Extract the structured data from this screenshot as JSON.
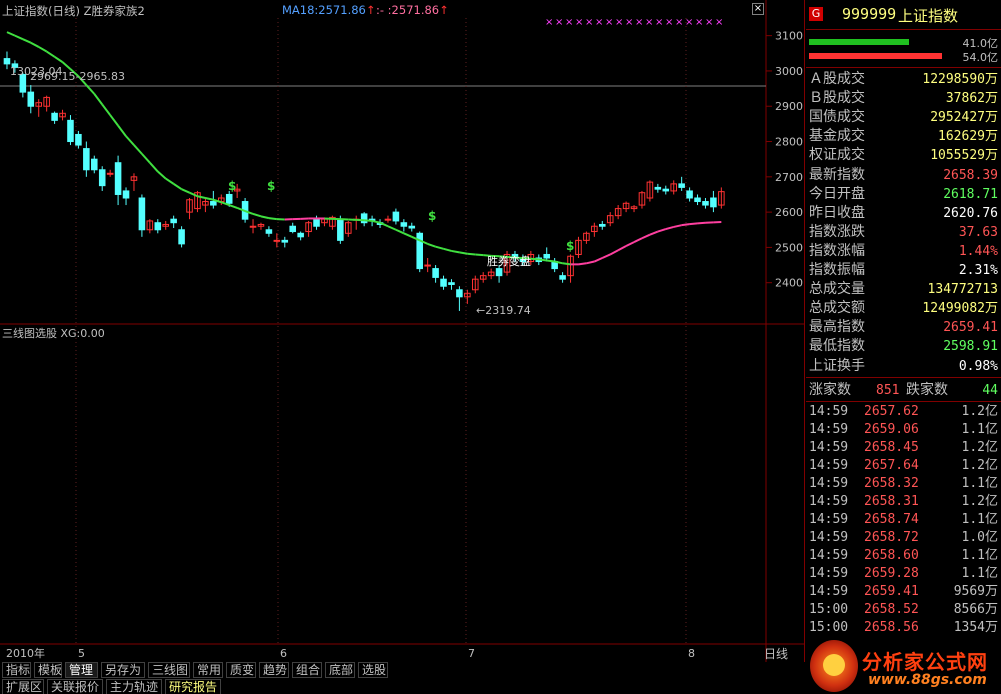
{
  "header": {
    "title": "上证指数(日线) Z胜券家族2",
    "ma_label": "MA18:2571.86",
    "ma_label2": ":- :2571.86"
  },
  "y_axis": [
    "3100",
    "3000",
    "2900",
    "2800",
    "2700",
    "2600",
    "2500",
    "2400"
  ],
  "annotations": {
    "high_label": "13023.04",
    "range_label": "2969.15-2965.83",
    "low_label": "←2319.74",
    "signal_text": "胜券变盘"
  },
  "indicator": {
    "label": "三线图选股  XG:0.00"
  },
  "x_axis": [
    "2010年",
    "5",
    "6",
    "7",
    "8"
  ],
  "period": "日线",
  "colors": {
    "up": "#ff3232",
    "down": "#54ffff",
    "ma_green": "#40e040",
    "ma_pink": "#ff3fa0",
    "axis": "#800000"
  },
  "panel": {
    "code": "999999",
    "name": "上证指数",
    "g_badge": "G",
    "bar1_label": "41.0亿",
    "bar2_label": "54.0亿",
    "stats": [
      {
        "label": "Ａ股成交",
        "value": "12298590万",
        "color": "#ffff80"
      },
      {
        "label": "Ｂ股成交",
        "value": "37862万",
        "color": "#ffff80"
      },
      {
        "label": "国债成交",
        "value": "2952427万",
        "color": "#ffff80"
      },
      {
        "label": "基金成交",
        "value": "162629万",
        "color": "#ffff80"
      },
      {
        "label": "权证成交",
        "value": "1055529万",
        "color": "#ffff80"
      },
      {
        "label": "最新指数",
        "value": "2658.39",
        "color": "#ff5555"
      },
      {
        "label": "今日开盘",
        "value": "2618.71",
        "color": "#60ff60"
      },
      {
        "label": "昨日收盘",
        "value": "2620.76",
        "color": "#ffffff"
      },
      {
        "label": "指数涨跌",
        "value": "37.63",
        "color": "#ff5555"
      },
      {
        "label": "指数涨幅",
        "value": "1.44%",
        "color": "#ff5555"
      },
      {
        "label": "指数振幅",
        "value": "2.31%",
        "color": "#ffffff"
      },
      {
        "label": "总成交量",
        "value": "134772713",
        "color": "#ffff80"
      },
      {
        "label": "总成交额",
        "value": "12499082万",
        "color": "#ffff80"
      },
      {
        "label": "最高指数",
        "value": "2659.41",
        "color": "#ff5555"
      },
      {
        "label": "最低指数",
        "value": "2598.91",
        "color": "#60ff60"
      },
      {
        "label": "上证换手",
        "value": "0.98%",
        "color": "#ffffff"
      }
    ],
    "updown": {
      "up_label": "涨家数",
      "up_value": "851",
      "down_label": "跌家数",
      "down_value": "44"
    },
    "ticks": [
      {
        "time": "14:59",
        "price": "2657.62",
        "vol": "1.2亿"
      },
      {
        "time": "14:59",
        "price": "2659.06",
        "vol": "1.1亿"
      },
      {
        "time": "14:59",
        "price": "2658.45",
        "vol": "1.2亿"
      },
      {
        "time": "14:59",
        "price": "2657.64",
        "vol": "1.2亿"
      },
      {
        "time": "14:59",
        "price": "2658.32",
        "vol": "1.1亿"
      },
      {
        "time": "14:59",
        "price": "2658.31",
        "vol": "1.2亿"
      },
      {
        "time": "14:59",
        "price": "2658.74",
        "vol": "1.1亿"
      },
      {
        "time": "14:59",
        "price": "2658.72",
        "vol": "1.0亿"
      },
      {
        "time": "14:59",
        "price": "2658.60",
        "vol": "1.1亿"
      },
      {
        "time": "14:59",
        "price": "2659.28",
        "vol": "1.1亿"
      },
      {
        "time": "14:59",
        "price": "2659.41",
        "vol": "9569万"
      },
      {
        "time": "15:00",
        "price": "2658.52",
        "vol": "8566万"
      },
      {
        "time": "15:00",
        "price": "2658.56",
        "vol": "1354万"
      }
    ]
  },
  "toolbar": {
    "row1": [
      "指标",
      "模板",
      "管理",
      "另存为",
      "三线图",
      "常用",
      "质变",
      "趋势",
      "组合",
      "底部",
      "选股"
    ],
    "row2": [
      "扩展区",
      "关联报价",
      "主力轨迹",
      "研究报告"
    ]
  },
  "logo": {
    "text1": "分析家公式网",
    "text2": "www.88gs.com"
  },
  "chart_data": {
    "type": "candlestick",
    "ylim": [
      2300,
      3150
    ],
    "candles": [
      [
        3035,
        3055,
        3005,
        3020
      ],
      [
        3020,
        3030,
        2995,
        3010
      ],
      [
        2990,
        2995,
        2925,
        2940
      ],
      [
        2940,
        2960,
        2880,
        2900
      ],
      [
        2900,
        2920,
        2870,
        2910
      ],
      [
        2900,
        2930,
        2885,
        2925
      ],
      [
        2880,
        2885,
        2850,
        2860
      ],
      [
        2870,
        2890,
        2860,
        2880
      ],
      [
        2860,
        2875,
        2790,
        2800
      ],
      [
        2820,
        2830,
        2780,
        2790
      ],
      [
        2780,
        2800,
        2700,
        2720
      ],
      [
        2750,
        2760,
        2710,
        2720
      ],
      [
        2720,
        2730,
        2660,
        2675
      ],
      [
        2710,
        2720,
        2700,
        2710
      ],
      [
        2740,
        2760,
        2620,
        2650
      ],
      [
        2660,
        2670,
        2620,
        2640
      ],
      [
        2690,
        2710,
        2660,
        2700
      ],
      [
        2640,
        2650,
        2530,
        2550
      ],
      [
        2550,
        2580,
        2540,
        2575
      ],
      [
        2570,
        2580,
        2540,
        2550
      ],
      [
        2560,
        2575,
        2550,
        2565
      ],
      [
        2580,
        2590,
        2555,
        2570
      ],
      [
        2550,
        2560,
        2500,
        2510
      ],
      [
        2600,
        2640,
        2580,
        2635
      ],
      [
        2610,
        2660,
        2600,
        2655
      ],
      [
        2620,
        2640,
        2600,
        2630
      ],
      [
        2630,
        2660,
        2610,
        2620
      ],
      [
        2630,
        2650,
        2620,
        2640
      ],
      [
        2650,
        2660,
        2615,
        2625
      ],
      [
        2660,
        2680,
        2640,
        2665
      ],
      [
        2630,
        2640,
        2570,
        2580
      ],
      [
        2560,
        2580,
        2540,
        2560
      ],
      [
        2560,
        2570,
        2550,
        2565
      ],
      [
        2550,
        2560,
        2530,
        2540
      ],
      [
        2520,
        2540,
        2500,
        2520
      ],
      [
        2520,
        2530,
        2500,
        2515
      ],
      [
        2560,
        2570,
        2540,
        2545
      ],
      [
        2540,
        2545,
        2520,
        2530
      ],
      [
        2545,
        2575,
        2530,
        2570
      ],
      [
        2580,
        2590,
        2550,
        2560
      ],
      [
        2570,
        2585,
        2560,
        2580
      ],
      [
        2560,
        2590,
        2550,
        2585
      ],
      [
        2580,
        2590,
        2510,
        2520
      ],
      [
        2540,
        2575,
        2530,
        2570
      ],
      [
        2580,
        2590,
        2550,
        2580
      ],
      [
        2595,
        2600,
        2560,
        2570
      ],
      [
        2580,
        2590,
        2560,
        2575
      ],
      [
        2570,
        2580,
        2555,
        2565
      ],
      [
        2580,
        2590,
        2570,
        2580
      ],
      [
        2600,
        2610,
        2565,
        2575
      ],
      [
        2570,
        2580,
        2545,
        2560
      ],
      [
        2560,
        2570,
        2545,
        2555
      ],
      [
        2540,
        2545,
        2430,
        2440
      ],
      [
        2450,
        2470,
        2430,
        2450
      ],
      [
        2440,
        2450,
        2400,
        2415
      ],
      [
        2410,
        2420,
        2380,
        2390
      ],
      [
        2400,
        2410,
        2380,
        2395
      ],
      [
        2380,
        2390,
        2320,
        2360
      ],
      [
        2360,
        2380,
        2340,
        2370
      ],
      [
        2380,
        2420,
        2370,
        2410
      ],
      [
        2410,
        2430,
        2400,
        2420
      ],
      [
        2420,
        2440,
        2410,
        2430
      ],
      [
        2440,
        2450,
        2400,
        2420
      ],
      [
        2430,
        2490,
        2420,
        2480
      ],
      [
        2480,
        2490,
        2460,
        2470
      ],
      [
        2470,
        2480,
        2450,
        2460
      ],
      [
        2460,
        2490,
        2450,
        2480
      ],
      [
        2470,
        2480,
        2450,
        2460
      ],
      [
        2480,
        2500,
        2460,
        2470
      ],
      [
        2460,
        2470,
        2430,
        2440
      ],
      [
        2420,
        2430,
        2400,
        2410
      ],
      [
        2420,
        2480,
        2400,
        2475
      ],
      [
        2480,
        2530,
        2470,
        2520
      ],
      [
        2520,
        2545,
        2510,
        2540
      ],
      [
        2545,
        2570,
        2530,
        2560
      ],
      [
        2565,
        2575,
        2550,
        2560
      ],
      [
        2570,
        2600,
        2560,
        2590
      ],
      [
        2590,
        2620,
        2580,
        2610
      ],
      [
        2610,
        2630,
        2600,
        2625
      ],
      [
        2610,
        2620,
        2600,
        2615
      ],
      [
        2620,
        2660,
        2610,
        2655
      ],
      [
        2640,
        2690,
        2630,
        2685
      ],
      [
        2670,
        2680,
        2655,
        2665
      ],
      [
        2665,
        2675,
        2650,
        2660
      ],
      [
        2660,
        2690,
        2650,
        2680
      ],
      [
        2680,
        2700,
        2660,
        2670
      ],
      [
        2660,
        2670,
        2630,
        2640
      ],
      [
        2640,
        2650,
        2620,
        2630
      ],
      [
        2630,
        2640,
        2610,
        2620
      ],
      [
        2640,
        2660,
        2600,
        2615
      ],
      [
        2620,
        2670,
        2610,
        2658
      ]
    ],
    "ma": [
      3110,
      3100,
      3090,
      3080,
      3068,
      3055,
      3040,
      3025,
      3005,
      2985,
      2960,
      2935,
      2905,
      2875,
      2845,
      2815,
      2790,
      2765,
      2740,
      2715,
      2695,
      2680,
      2665,
      2655,
      2645,
      2640,
      2635,
      2628,
      2620,
      2612,
      2603,
      2595,
      2588,
      2583,
      2580,
      2579,
      2580,
      2581,
      2582,
      2582,
      2582,
      2581,
      2580,
      2579,
      2578,
      2577,
      2575,
      2570,
      2560,
      2550,
      2540,
      2530,
      2520,
      2510,
      2502,
      2496,
      2490,
      2486,
      2482,
      2480,
      2478,
      2476,
      2475,
      2473,
      2471,
      2470,
      2468,
      2466,
      2463,
      2460,
      2455,
      2452,
      2452,
      2455,
      2460,
      2470,
      2480,
      2492,
      2504,
      2515,
      2526,
      2536,
      2545,
      2552,
      2558,
      2563,
      2566,
      2568,
      2570,
      2571,
      2571.86
    ]
  }
}
